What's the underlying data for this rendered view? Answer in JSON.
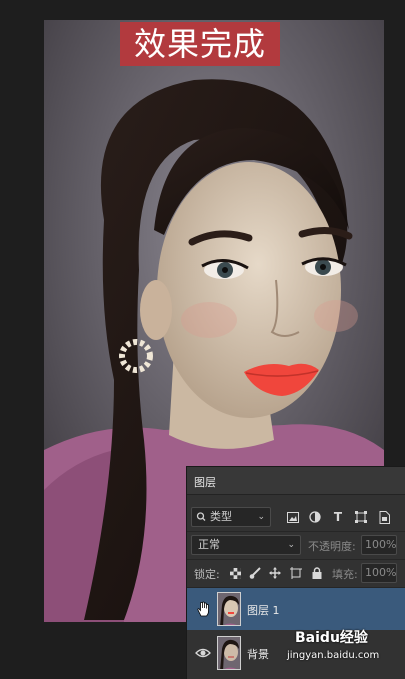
{
  "banner": {
    "title": "效果完成"
  },
  "layers_panel": {
    "tab": "图层",
    "filter_kind": "类型",
    "blend_mode": "正常",
    "opacity_label": "不透明度:",
    "opacity_value": "100%",
    "lock_label": "锁定:",
    "fill_label": "填充:",
    "fill_value": "100%",
    "layers": [
      {
        "name": "图层 1",
        "selected": true
      },
      {
        "name": "背景",
        "selected": false
      }
    ]
  },
  "watermark": {
    "brand": "Baidu经验",
    "url": "jingyan.baidu.com"
  },
  "icons": {
    "image_filter": "image-icon",
    "adjust_filter": "adjustment-icon",
    "type_filter": "type-icon",
    "shape_filter": "shape-icon",
    "smart_filter": "smart-object-icon"
  },
  "colors": {
    "banner_bg": "#b23a3e",
    "selected_layer": "#3a5a7c",
    "lips": "#f0463c"
  }
}
